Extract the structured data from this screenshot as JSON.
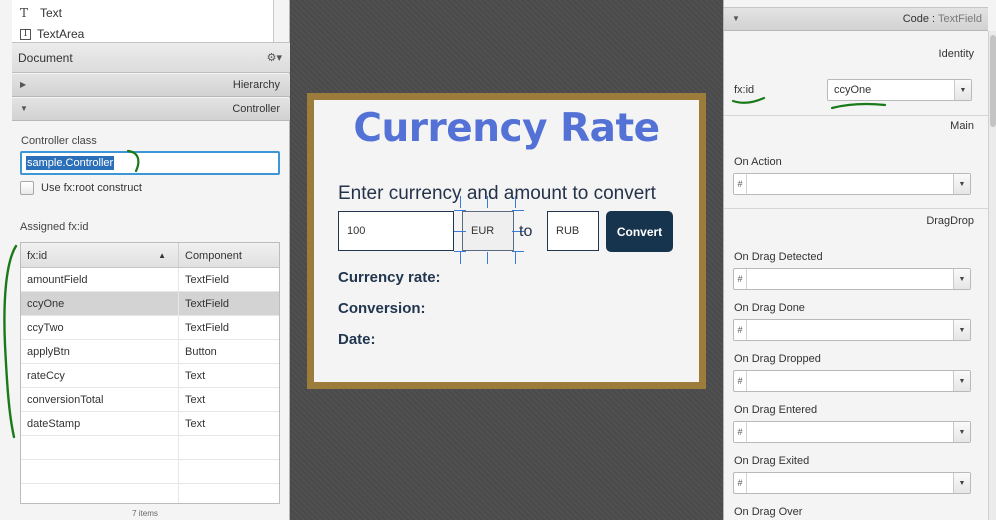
{
  "library": {
    "items": [
      {
        "label": "Text",
        "icon": "text-icon"
      },
      {
        "label": "TextArea",
        "icon": "textarea-icon"
      }
    ]
  },
  "document": {
    "title": "Document",
    "gear": "⚙▾",
    "hierarchy_label": "Hierarchy",
    "controller_label": "Controller",
    "controller_class_label": "Controller class",
    "controller_class_value": "sample.Controller",
    "fxroot_label": "Use fx:root construct",
    "assigned_label": "Assigned fx:id",
    "table": {
      "headers": [
        "fx:id",
        "Component"
      ],
      "rows": [
        [
          "amountField",
          "TextField"
        ],
        [
          "ccyOne",
          "TextField"
        ],
        [
          "ccyTwo",
          "TextField"
        ],
        [
          "applyBtn",
          "Button"
        ],
        [
          "rateCcy",
          "Text"
        ],
        [
          "conversionTotal",
          "Text"
        ],
        [
          "dateStamp",
          "Text"
        ],
        [
          "",
          ""
        ],
        [
          "",
          ""
        ],
        [
          "",
          ""
        ]
      ],
      "selected_row": 1
    },
    "item_count": "7 items"
  },
  "form": {
    "title": "Currency Rate",
    "subtitle": "Enter currency and amount to convert",
    "amount_value": "100",
    "ccy_one_value": "EUR",
    "to_label": "to",
    "ccy_two_value": "RUB",
    "convert_label": "Convert",
    "currency_rate_label": "Currency rate:",
    "conversion_label": "Conversion:",
    "date_label": "Date:"
  },
  "inspector": {
    "header_prefix": "Code : ",
    "header_type": "TextField",
    "identity_label": "Identity",
    "fxid_label": "fx:id",
    "fxid_value": "ccyOne",
    "main_label": "Main",
    "on_action_label": "On Action",
    "dragdrop_label": "DragDrop",
    "handlers": [
      "On Drag Detected",
      "On Drag Done",
      "On Drag Dropped",
      "On Drag Entered",
      "On Drag Exited",
      "On Drag Over"
    ],
    "hash": "#"
  },
  "colors": {
    "title_blue": "#5472d6",
    "button_navy": "#17344f",
    "frame_gold": "#9b7c3b",
    "annotation_green": "#1a7a1a",
    "selection_blue": "#2b6fb8"
  }
}
